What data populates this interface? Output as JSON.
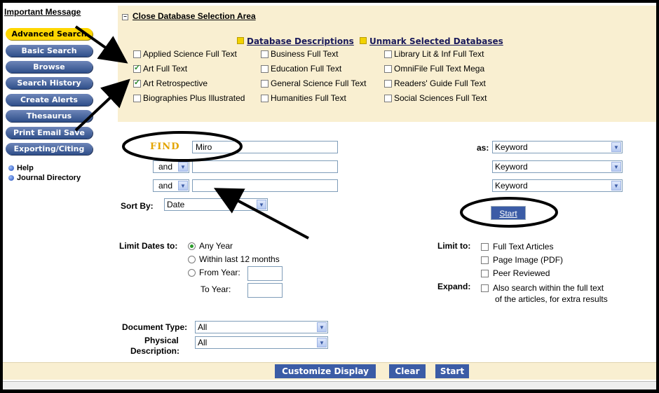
{
  "important_message": "Important Message",
  "nav": {
    "buttons": [
      "Advanced Search",
      "Basic Search",
      "Browse",
      "Search History",
      "Create Alerts",
      "Thesaurus",
      "Print Email Save",
      "Exporting/Citing"
    ],
    "links": [
      "Help",
      "Journal Directory"
    ]
  },
  "db_area": {
    "close_link": "Close Database Selection Area",
    "descriptions_link": "Database Descriptions",
    "unmark_link": "Unmark Selected Databases",
    "databases": [
      {
        "label": "Applied Science Full Text",
        "checked": false
      },
      {
        "label": "Business Full Text",
        "checked": false
      },
      {
        "label": "Library Lit & Inf Full Text",
        "checked": false
      },
      {
        "label": "Art Full Text",
        "checked": true
      },
      {
        "label": "Education Full Text",
        "checked": false
      },
      {
        "label": "OmniFile Full Text Mega",
        "checked": false
      },
      {
        "label": "Art Retrospective",
        "checked": true
      },
      {
        "label": "General Science Full Text",
        "checked": false
      },
      {
        "label": "Readers' Guide Full Text",
        "checked": false
      },
      {
        "label": "Biographies Plus Illustrated",
        "checked": false
      },
      {
        "label": "Humanities Full Text",
        "checked": false
      },
      {
        "label": "Social Sciences Full Text",
        "checked": false
      }
    ]
  },
  "search": {
    "find_label": "FIND",
    "row1_value": "Miro",
    "operators": [
      "and",
      "and"
    ],
    "as_label": "as:",
    "field_types": [
      "Keyword",
      "Keyword",
      "Keyword"
    ],
    "sort_label": "Sort By:",
    "sort_value": "Date",
    "start_label": "Start"
  },
  "limits": {
    "limit_dates_label": "Limit Dates to:",
    "any_year": "Any Year",
    "within_12": "Within last 12 months",
    "from_year": "From Year:",
    "to_year": "To Year:",
    "limit_to_label": "Limit to:",
    "full_text": "Full Text Articles",
    "page_image": "Page Image (PDF)",
    "peer_reviewed": "Peer Reviewed",
    "expand_label": "Expand:",
    "expand_text_1": "Also search within the full text",
    "expand_text_2": "of the articles, for extra results"
  },
  "doc": {
    "document_type_label": "Document Type:",
    "document_type_value": "All",
    "physical_label_1": "Physical",
    "physical_label_2": "Description:",
    "physical_value": "All"
  },
  "bottom": {
    "customize": "Customize Display",
    "clear": "Clear",
    "start": "Start"
  }
}
